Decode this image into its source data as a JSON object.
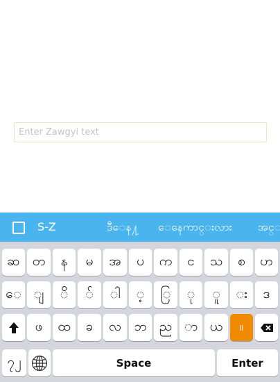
{
  "input": {
    "placeholder": "Enter Zawgyi text",
    "value": ""
  },
  "toolbar": {
    "checkbox_icon": "checkbox-icon",
    "suggestions": [
      "S-Z",
      "ဒီေန႔",
      "ေနေကာင္းလား",
      "အင္း"
    ]
  },
  "keyboard": {
    "rows": [
      [
        "ဆ",
        "တ",
        "န",
        "မ",
        "အ",
        "ပ",
        "က",
        "င",
        "သ",
        "စ",
        "ဟ"
      ],
      [
        "ေ",
        "ျ",
        "ိ",
        "်",
        "ါ",
        "့",
        "ြ",
        "ု",
        "ူ",
        "း",
        "ဒ"
      ],
      [
        "ဖ",
        "ထ",
        "ခ",
        "လ",
        "ဘ",
        "ည",
        "ာ",
        "ယ",
        "။"
      ]
    ],
    "numbers_key": "၇၂",
    "space_label": "Space",
    "enter_label": "Enter",
    "accent_color": "#f08a00",
    "toolbar_color": "#4ab4ef"
  }
}
